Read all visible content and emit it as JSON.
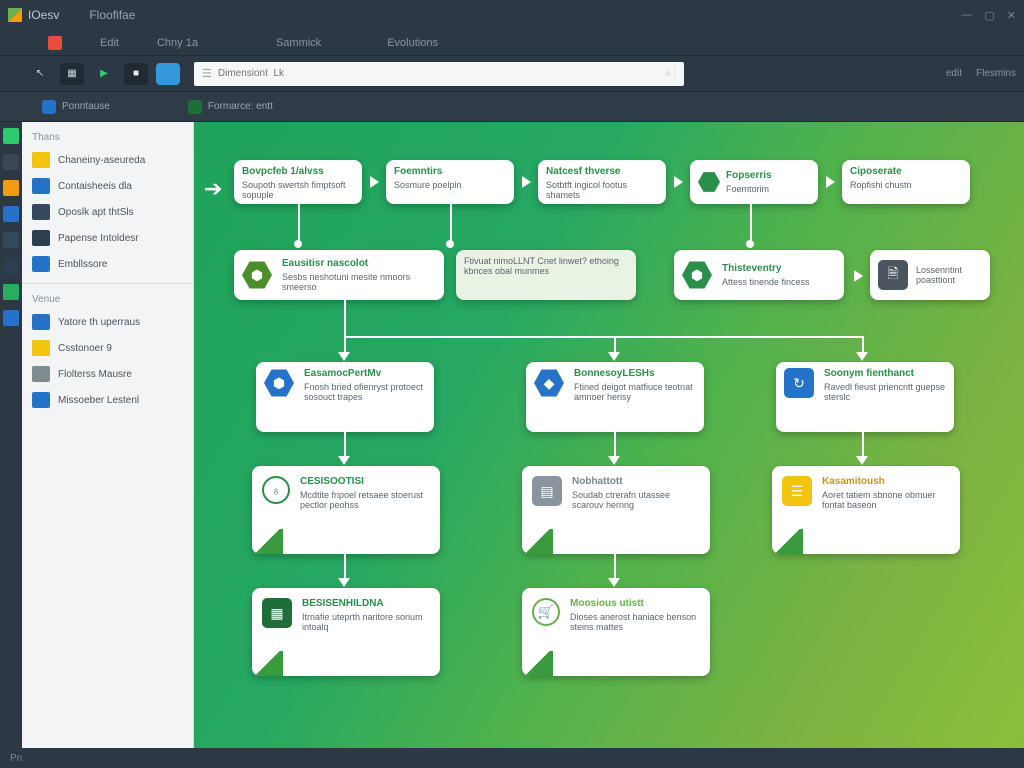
{
  "app": {
    "title": "IOesv",
    "subtitle": "Floofifae"
  },
  "menu": {
    "items": [
      "Edit",
      "Chny 1a",
      "Sammick",
      "Evolutions"
    ]
  },
  "ribbon": {
    "search_placeholder": "Dimensiont  Lk",
    "right_label_1": "edit",
    "right_label_2": "Flesmins"
  },
  "context": {
    "item1": "Ponntause",
    "item2": "Formarce: entt"
  },
  "sidebar": {
    "section1": "Thans",
    "items1": [
      "Chaneiny-aseureda",
      "Contaisheeis dla",
      "Oposlk apt thtSls",
      "Papense Intoldesr",
      "Embllssore"
    ],
    "section2": "Venue",
    "items2": [
      "Yatore th uperraus",
      "Csstonoer 9",
      "Flolterss Mausre",
      "Missoeber Lestenl"
    ]
  },
  "nodes": {
    "r1": [
      {
        "title": "Bovpcfeb 1/alvss",
        "sub": "Soupoth swertsh fimptsoft sopuple"
      },
      {
        "title": "Foemntirs",
        "sub": "Sosmure poelpin"
      },
      {
        "title": "Natcesf thverse",
        "sub": "Sotbtft ingicol footus shamets"
      },
      {
        "title": "Fopserris",
        "sub": "Foemtorim"
      },
      {
        "title": "Ciposerate",
        "sub": "Ropfishi chustn"
      }
    ],
    "r2a": {
      "title": "Eausitisr nascolot",
      "sub": "Sesbs neshotuni mesite nmoors smeerso"
    },
    "r2b": {
      "title": "",
      "sub": "Ftivuat nimoLLNT Cnet linwet? ethoing kbnces obal munmes"
    },
    "r2c": {
      "title": "Thisteventry",
      "sub": "Attess tinende fincess"
    },
    "r2d": {
      "title": "",
      "sub": "Lossenntint poasttiont"
    },
    "r3": [
      {
        "title": "EasamocPertMv",
        "sub": "Fnosh bried ofienryst protoect sosouct trapes"
      },
      {
        "title": "BonnesoyLESHs",
        "sub": "Ftined deigot matfiuce teotnat amnoer herisy"
      },
      {
        "title": "Soonym fienthanct",
        "sub": "Ravedl fieust priencritt guepse sterslc"
      }
    ],
    "r4": [
      {
        "title": "CESISOOTISI",
        "sub": "Mcdtite fripoel retsaee stoerust pectlor peohss"
      },
      {
        "title": "Nobhattott",
        "sub": "Soudab ctrerafn utassee scarouv hernng"
      },
      {
        "title": "Kasamitoush",
        "sub": "Aoret tatiem sbnone obmuer fontat baseon"
      }
    ],
    "r5": [
      {
        "title": "BESISENHILDNA",
        "sub": "Itrnafie uteprth naritore sonum intoalq"
      },
      {
        "title": "Moosious utistt",
        "sub": "Dioses anerost haniace benson steins mattes"
      }
    ]
  },
  "status": {
    "text": "Pn"
  }
}
